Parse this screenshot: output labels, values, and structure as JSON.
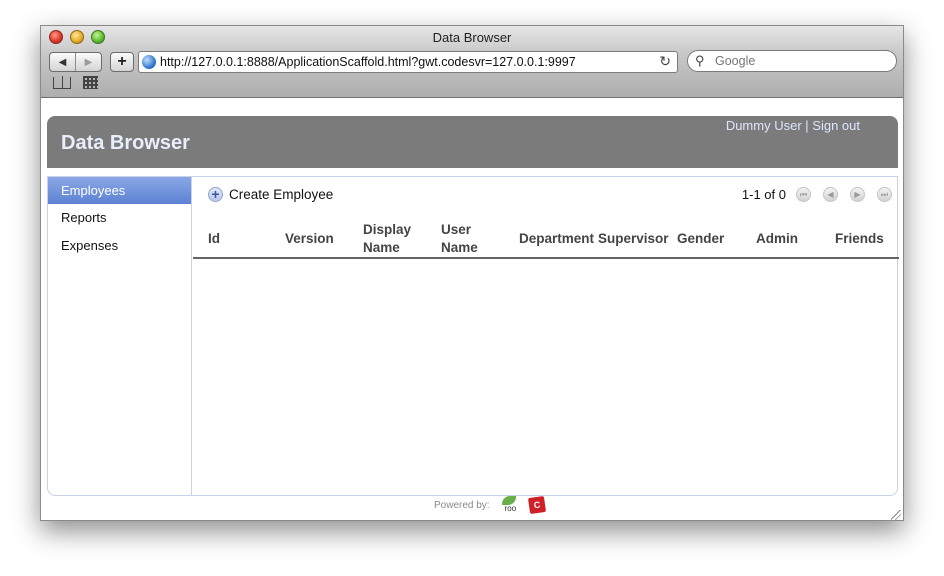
{
  "browser": {
    "window_title": "Data Browser",
    "url": "http://127.0.0.1:8888/ApplicationScaffold.html?gwt.codesvr=127.0.0.1:9997",
    "search_placeholder": "Google"
  },
  "app": {
    "title": "Data Browser",
    "user_name": "Dummy User",
    "separator": "|",
    "sign_out": "Sign out"
  },
  "sidebar": {
    "items": [
      {
        "label": "Employees",
        "selected": true
      },
      {
        "label": "Reports",
        "selected": false
      },
      {
        "label": "Expenses",
        "selected": false
      }
    ]
  },
  "toolbar": {
    "create_label": "Create Employee",
    "page_count": "1-1 of 0"
  },
  "table": {
    "columns": [
      {
        "line1": "Id",
        "line2": ""
      },
      {
        "line1": "Version",
        "line2": ""
      },
      {
        "line1": "Display",
        "line2": "Name"
      },
      {
        "line1": "User",
        "line2": "Name"
      },
      {
        "line1": "Department",
        "line2": ""
      },
      {
        "line1": "Supervisor",
        "line2": ""
      },
      {
        "line1": "Gender",
        "line2": ""
      },
      {
        "line1": "Admin",
        "line2": ""
      },
      {
        "line1": "Friends",
        "line2": ""
      }
    ],
    "rows": []
  },
  "footer": {
    "powered_by": "Powered by:",
    "roo_text": "spring roo",
    "roo_badge": "C"
  },
  "colors": {
    "header_bg": "#7b7b7b",
    "selected_item": "#5d82d3",
    "border": "#c9d2ea"
  }
}
